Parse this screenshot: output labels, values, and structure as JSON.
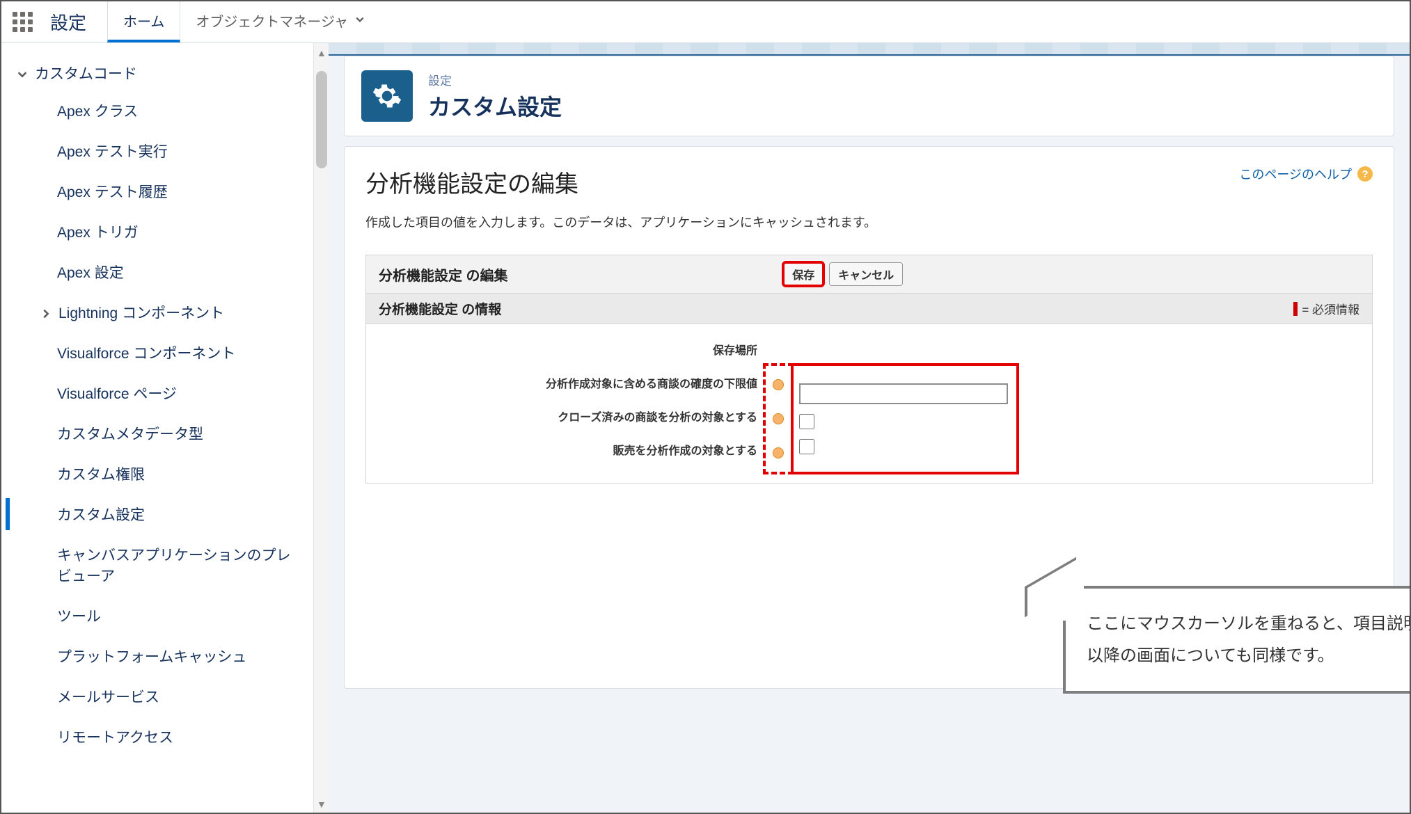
{
  "topnav": {
    "app_title": "設定",
    "tabs": [
      {
        "label": "ホーム",
        "active": true
      },
      {
        "label": "オブジェクトマネージャ",
        "active": false,
        "dropdown": true
      }
    ]
  },
  "sidebar": {
    "parent_label": "カスタムコード",
    "items": [
      {
        "label": "Apex クラス"
      },
      {
        "label": "Apex テスト実行"
      },
      {
        "label": "Apex テスト履歴"
      },
      {
        "label": "Apex トリガ"
      },
      {
        "label": "Apex 設定"
      },
      {
        "label": "Lightning コンポーネント",
        "expandable": true
      },
      {
        "label": "Visualforce コンポーネント"
      },
      {
        "label": "Visualforce ページ"
      },
      {
        "label": "カスタムメタデータ型"
      },
      {
        "label": "カスタム権限"
      },
      {
        "label": "カスタム設定",
        "active": true
      },
      {
        "label": "キャンバスアプリケーションのプレビューア"
      },
      {
        "label": "ツール"
      },
      {
        "label": "プラットフォームキャッシュ"
      },
      {
        "label": "メールサービス"
      },
      {
        "label": "リモートアクセス"
      }
    ]
  },
  "page_header": {
    "breadcrumb": "設定",
    "title": "カスタム設定"
  },
  "panel": {
    "heading": "分析機能設定の編集",
    "help_text": "このページのヘルプ",
    "description": "作成した項目の値を入力します。このデータは、アプリケーションにキャッシュされます。",
    "pb_header_title": "分析機能設定 の編集",
    "save_label": "保存",
    "cancel_label": "キャンセル",
    "sub_title": "分析機能設定 の情報",
    "required_legend": "= 必須情報",
    "location_label": "保存場所",
    "fields": {
      "opp_prob_min": {
        "label": "分析作成対象に含める商談の確度の下限値",
        "value": "",
        "type": "text"
      },
      "include_closed": {
        "label": "クローズ済みの商談を分析の対象とする",
        "checked": false,
        "type": "checkbox"
      },
      "include_sales": {
        "label": "販売を分析作成の対象とする",
        "checked": false,
        "type": "checkbox"
      }
    }
  },
  "callout": {
    "line1": "ここにマウスカーソルを重ねると、項目説明が表示されます。",
    "line2": "以降の画面についても同様です。"
  }
}
